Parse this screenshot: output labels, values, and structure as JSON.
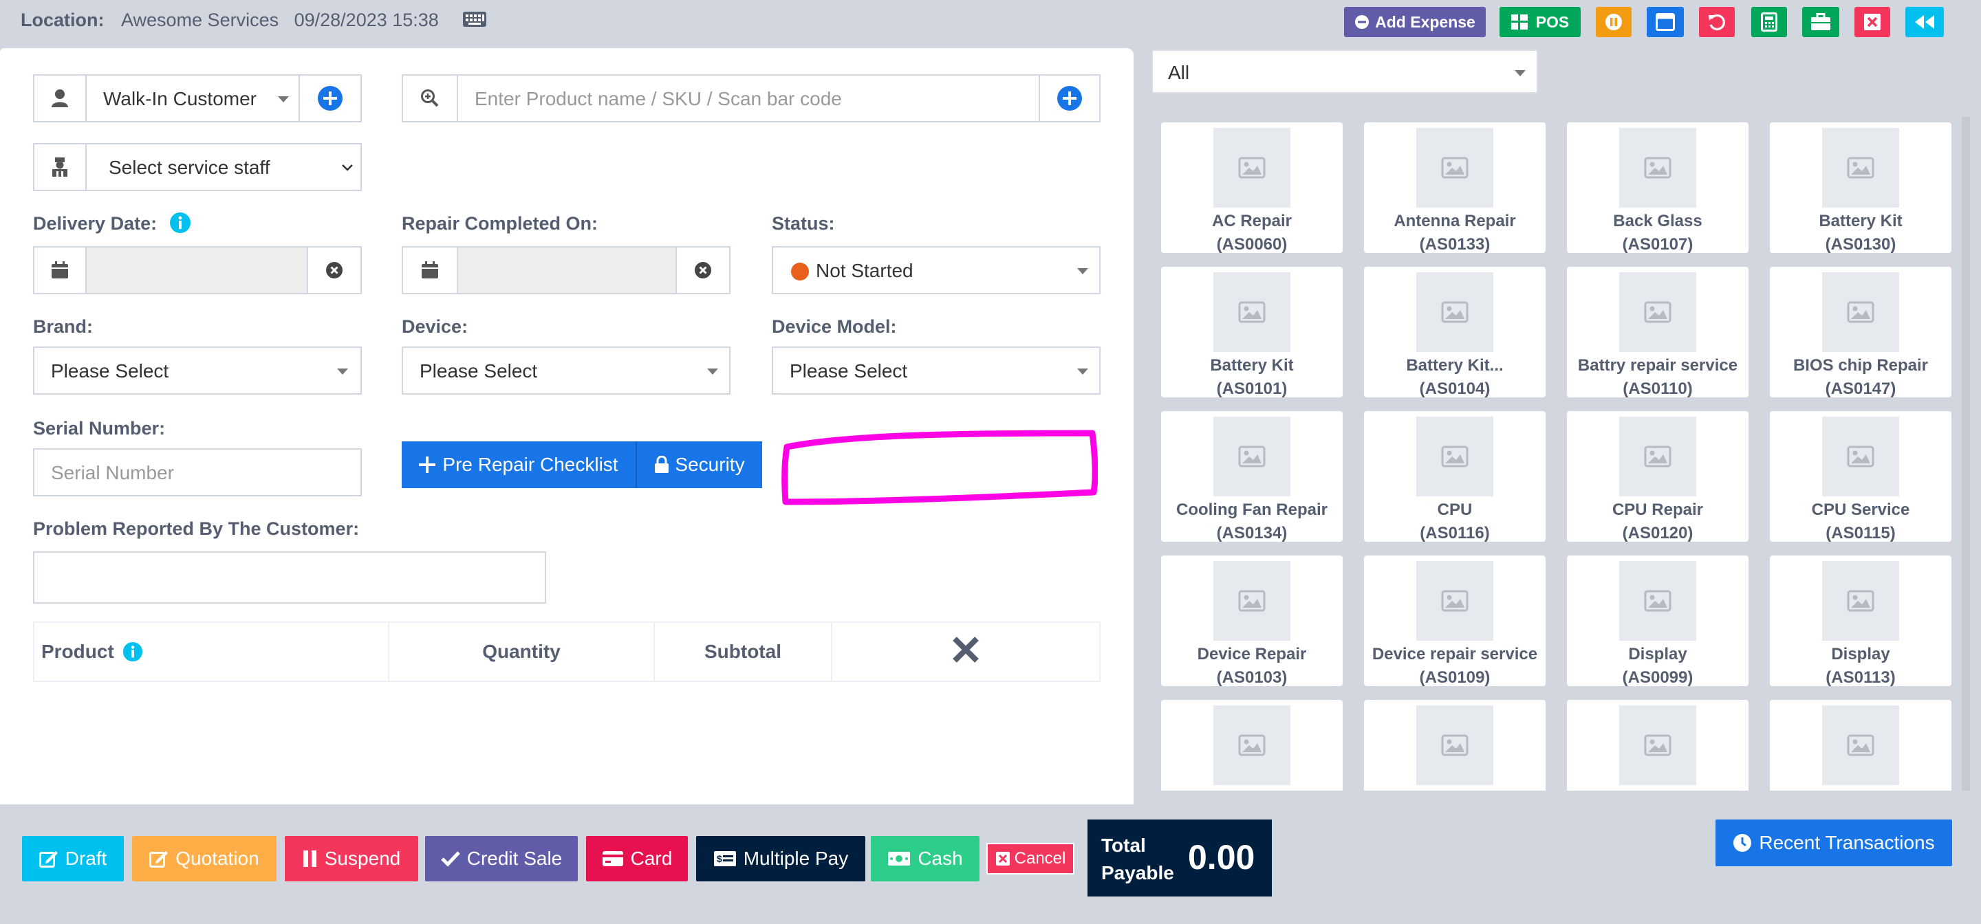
{
  "header": {
    "location_label": "Location:",
    "location_value": "Awesome Services",
    "datetime": "09/28/2023 15:38",
    "add_expense": "Add Expense",
    "pos": "POS"
  },
  "customer": {
    "selected": "Walk-In Customer",
    "service_staff_placeholder": "Select service staff"
  },
  "search": {
    "placeholder": "Enter Product name / SKU / Scan bar code"
  },
  "labels": {
    "delivery_date": "Delivery Date:",
    "repair_completed_on": "Repair Completed On:",
    "status": "Status:",
    "brand": "Brand:",
    "device": "Device:",
    "device_model": "Device Model:",
    "serial_number": "Serial Number:",
    "problem_reported": "Problem Reported By The Customer:"
  },
  "status_value": "Not Started",
  "status_color": "#e8601c",
  "brand_value": "Please Select",
  "device_value": "Please Select",
  "device_model_value": "Please Select",
  "serial_placeholder": "Serial Number",
  "buttons": {
    "pre_repair_checklist": "Pre Repair Checklist",
    "security": "Security"
  },
  "table": {
    "product": "Product",
    "quantity": "Quantity",
    "subtotal": "Subtotal"
  },
  "category_filter": "All",
  "products": [
    {
      "name": "AC Repair",
      "sku": "(AS0060)"
    },
    {
      "name": "Antenna Repair",
      "sku": "(AS0133)"
    },
    {
      "name": "Back Glass",
      "sku": "(AS0107)"
    },
    {
      "name": "Battery Kit",
      "sku": "(AS0130)"
    },
    {
      "name": "Battery Kit",
      "sku": "(AS0101)"
    },
    {
      "name": "Battery Kit...",
      "sku": "(AS0104)"
    },
    {
      "name": "Battry repair service",
      "sku": "(AS0110)"
    },
    {
      "name": "BIOS chip Repair",
      "sku": "(AS0147)"
    },
    {
      "name": "Cooling Fan Repair",
      "sku": "(AS0134)"
    },
    {
      "name": "CPU",
      "sku": "(AS0116)"
    },
    {
      "name": "CPU Repair",
      "sku": "(AS0120)"
    },
    {
      "name": "CPU Service",
      "sku": "(AS0115)"
    },
    {
      "name": "Device Repair",
      "sku": "(AS0103)"
    },
    {
      "name": "Device repair service",
      "sku": "(AS0109)"
    },
    {
      "name": "Display",
      "sku": "(AS0099)"
    },
    {
      "name": "Display",
      "sku": "(AS0113)"
    },
    {
      "name": "",
      "sku": ""
    },
    {
      "name": "",
      "sku": ""
    },
    {
      "name": "",
      "sku": ""
    },
    {
      "name": "",
      "sku": ""
    }
  ],
  "footer": {
    "draft": "Draft",
    "quotation": "Quotation",
    "suspend": "Suspend",
    "credit_sale": "Credit Sale",
    "card": "Card",
    "multiple_pay": "Multiple Pay",
    "cash": "Cash",
    "cancel": "Cancel",
    "total_payable_line1": "Total",
    "total_payable_line2": "Payable",
    "total_value": "0.00",
    "recent_transactions": "Recent Transactions"
  },
  "colors": {
    "primary": "#1775e8",
    "add_expense": "#605ca8",
    "pos": "#00a65a",
    "draft": "#00c0ef",
    "quotation": "#ffad46",
    "suspend": "#f5365c",
    "credit_sale": "#605ca8",
    "card": "#e8114f",
    "multiple_pay": "#001f3f",
    "cash": "#2dce89",
    "cancel": "#f5365c",
    "annotation": "#ff00e6"
  }
}
